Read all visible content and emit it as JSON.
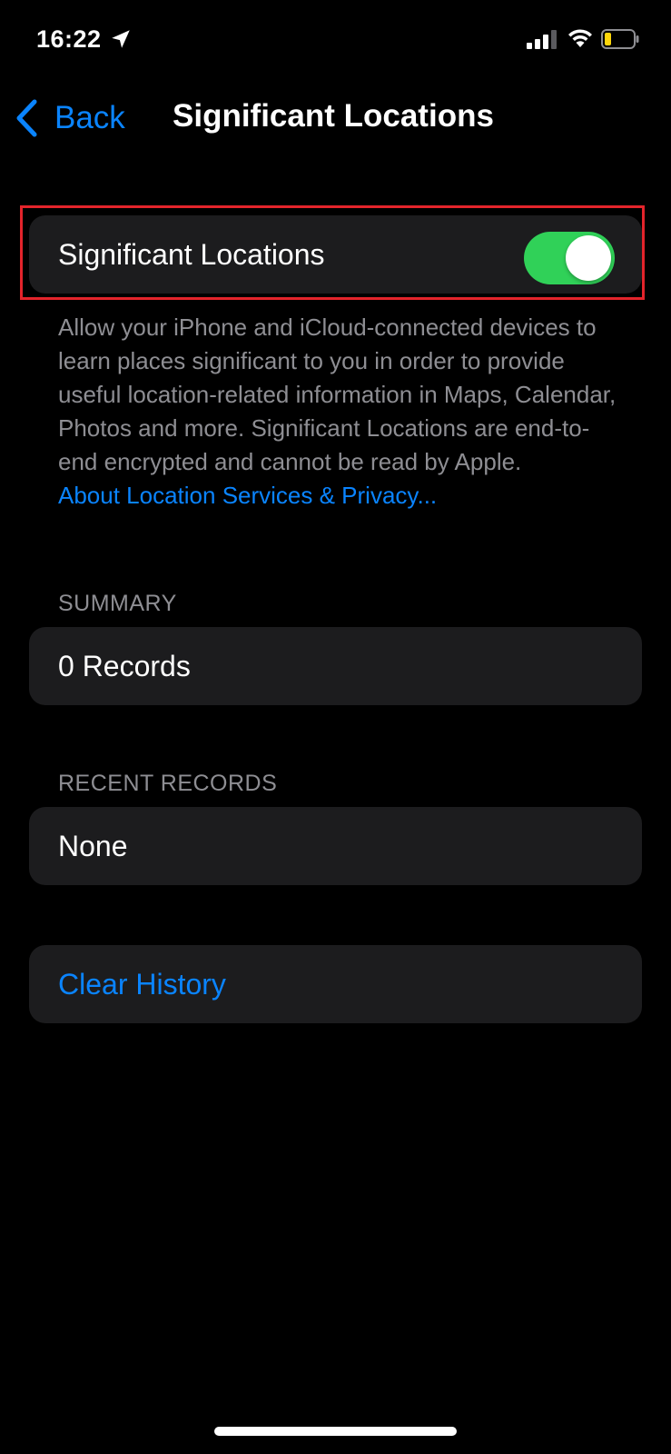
{
  "status_bar": {
    "time": "16:22",
    "location_icon": "location-arrow-icon",
    "signal_icon": "cellular-signal-icon",
    "wifi_icon": "wifi-icon",
    "battery_icon": "battery-low-icon",
    "battery_color": "#ffd60a"
  },
  "nav": {
    "back_label": "Back",
    "title": "Significant Locations"
  },
  "toggle_row": {
    "label": "Significant Locations",
    "enabled": true,
    "toggle_color": "#30d158"
  },
  "description": {
    "text": "Allow your iPhone and iCloud-connected devices to learn places significant to you in order to provide useful location-related information in Maps, Calendar, Photos and more. Significant Locations are end-to-end encrypted and cannot be read by Apple.",
    "link": "About Location Services & Privacy..."
  },
  "summary": {
    "header": "SUMMARY",
    "value": "0 Records"
  },
  "recent": {
    "header": "RECENT RECORDS",
    "value": "None"
  },
  "actions": {
    "clear_history": "Clear History"
  },
  "colors": {
    "accent": "#0a84ff",
    "highlight": "#e3242b",
    "card_bg": "#1c1c1e"
  }
}
